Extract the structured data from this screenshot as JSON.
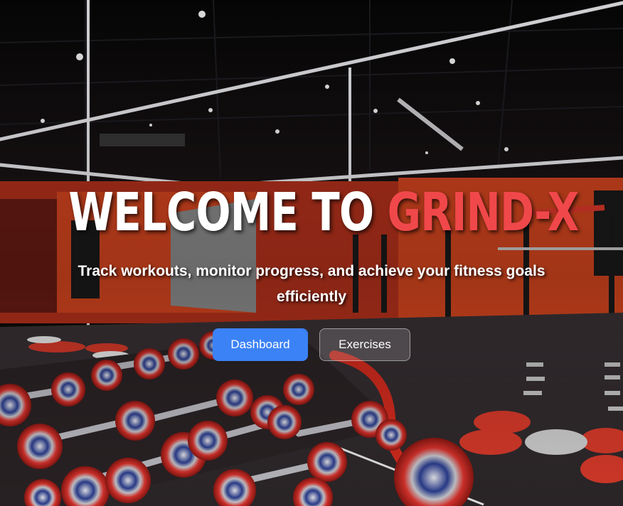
{
  "hero": {
    "title_main": "WELCOME TO",
    "title_accent": "GRIND-X",
    "subtitle": "Track workouts, monitor progress, and achieve your fitness goals efficiently"
  },
  "buttons": {
    "dashboard": "Dashboard",
    "exercises": "Exercises"
  },
  "colors": {
    "accent": "#f0484a",
    "primary_button": "#3b82f6",
    "text": "#ffffff"
  }
}
